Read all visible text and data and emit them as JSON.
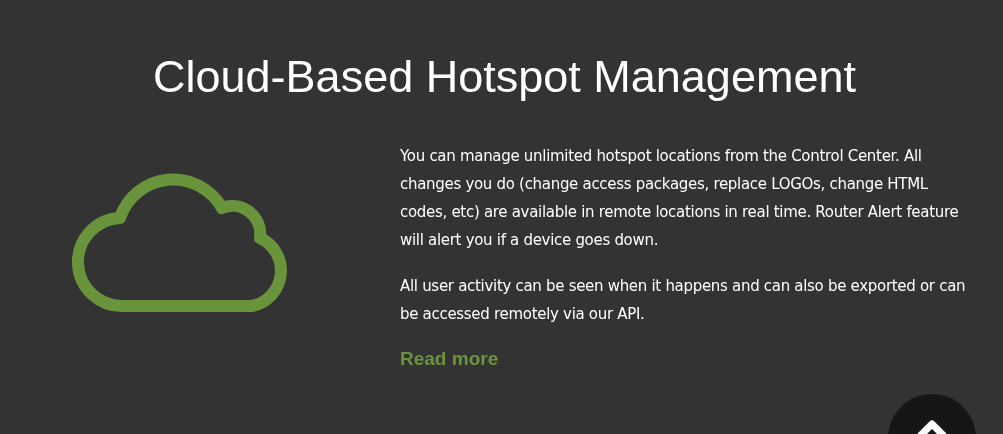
{
  "title": "Cloud-Based Hotspot Management",
  "paragraphs": [
    "You can manage unlimited hotspot locations from the Control Center. All changes you do (change access packages, replace LOGOs, change HTML codes, etc) are available in remote locations in real time. Router Alert feature will alert you if a device goes down.",
    "All user activity can be seen when it happens and can also be exported or can be accessed remotely via our API."
  ],
  "link": "Read more"
}
